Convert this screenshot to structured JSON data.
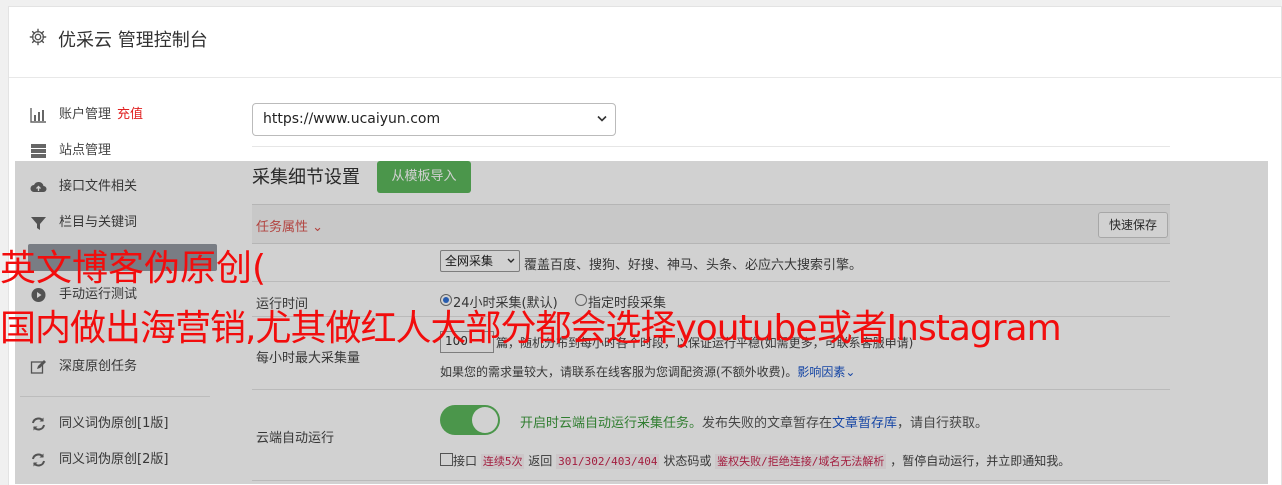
{
  "header": {
    "title": "优采云 管理控制台"
  },
  "sidebar": {
    "items": [
      {
        "label": "账户管理",
        "badge": "充值"
      },
      {
        "label": "站点管理"
      },
      {
        "label": "接口文件相关"
      },
      {
        "label": "栏目与关键词"
      },
      {
        "label": "手动运行测试"
      },
      {
        "label": "深度原创任务"
      },
      {
        "label": "同义词伪原创[1版]"
      },
      {
        "label": "同义词伪原创[2版]"
      }
    ]
  },
  "site_select": {
    "value": "https://www.ucaiyun.com"
  },
  "section": {
    "title": "采集细节设置",
    "import_button": "从模板导入"
  },
  "table": {
    "task_props": "任务属性",
    "quick_save": "快速保存"
  },
  "rows": {
    "scope": {
      "select_value": "全网采集",
      "desc": "覆盖百度、搜狗、好搜、神马、头条、必应六大搜索引擎。"
    },
    "run_time": {
      "label": "运行时间",
      "opt1": "24小时采集(默认)",
      "opt2": "指定时段采集"
    },
    "per_hour": {
      "label": "每小时最大采集量",
      "value": "100",
      "desc": "篇，随机分布到每小时各个时段，以保证运行平稳(如需更多，可联系客服申请)",
      "hint": "如果您的需求量较大，请联系在线客服为您调配资源(不额外收费)。",
      "hint_link": "影响因素"
    },
    "cloud": {
      "label": "云端自动运行",
      "on_text": "开启时云端自动运行采集任务。",
      "text2": "发布失败的文章暂存在",
      "link": "文章暂存库",
      "text3": "，请自行获取。",
      "err_prefix": "接口",
      "err_code1": "连续5次",
      "err_text1": "返回",
      "err_code2": "301/302/403/404",
      "err_text2": "状态码或",
      "err_code3": "鉴权失败/拒绝连接/域名无法解析",
      "err_text3": "，暂停自动运行，并立即通知我。"
    }
  },
  "watermark": {
    "line1": "英文博客伪原创(",
    "line2": "国内做出海营销,尤其做红人大部分都会选择youtube或者Instagram"
  }
}
